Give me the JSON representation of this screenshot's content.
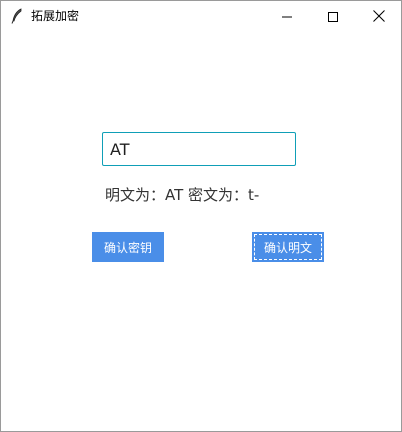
{
  "window": {
    "title": "拓展加密",
    "icon": "feather-icon",
    "controls": {
      "minimize_icon": "minimize-icon",
      "maximize_icon": "maximize-icon",
      "close_icon": "close-icon"
    }
  },
  "form": {
    "input_value": "AT",
    "result_text": "明文为：AT 密文为：t-",
    "confirm_key_label": "确认密钥",
    "confirm_plain_label": "确认明文"
  },
  "colors": {
    "accent_button": "#4a8ee8",
    "input_border": "#0f9fb7"
  }
}
